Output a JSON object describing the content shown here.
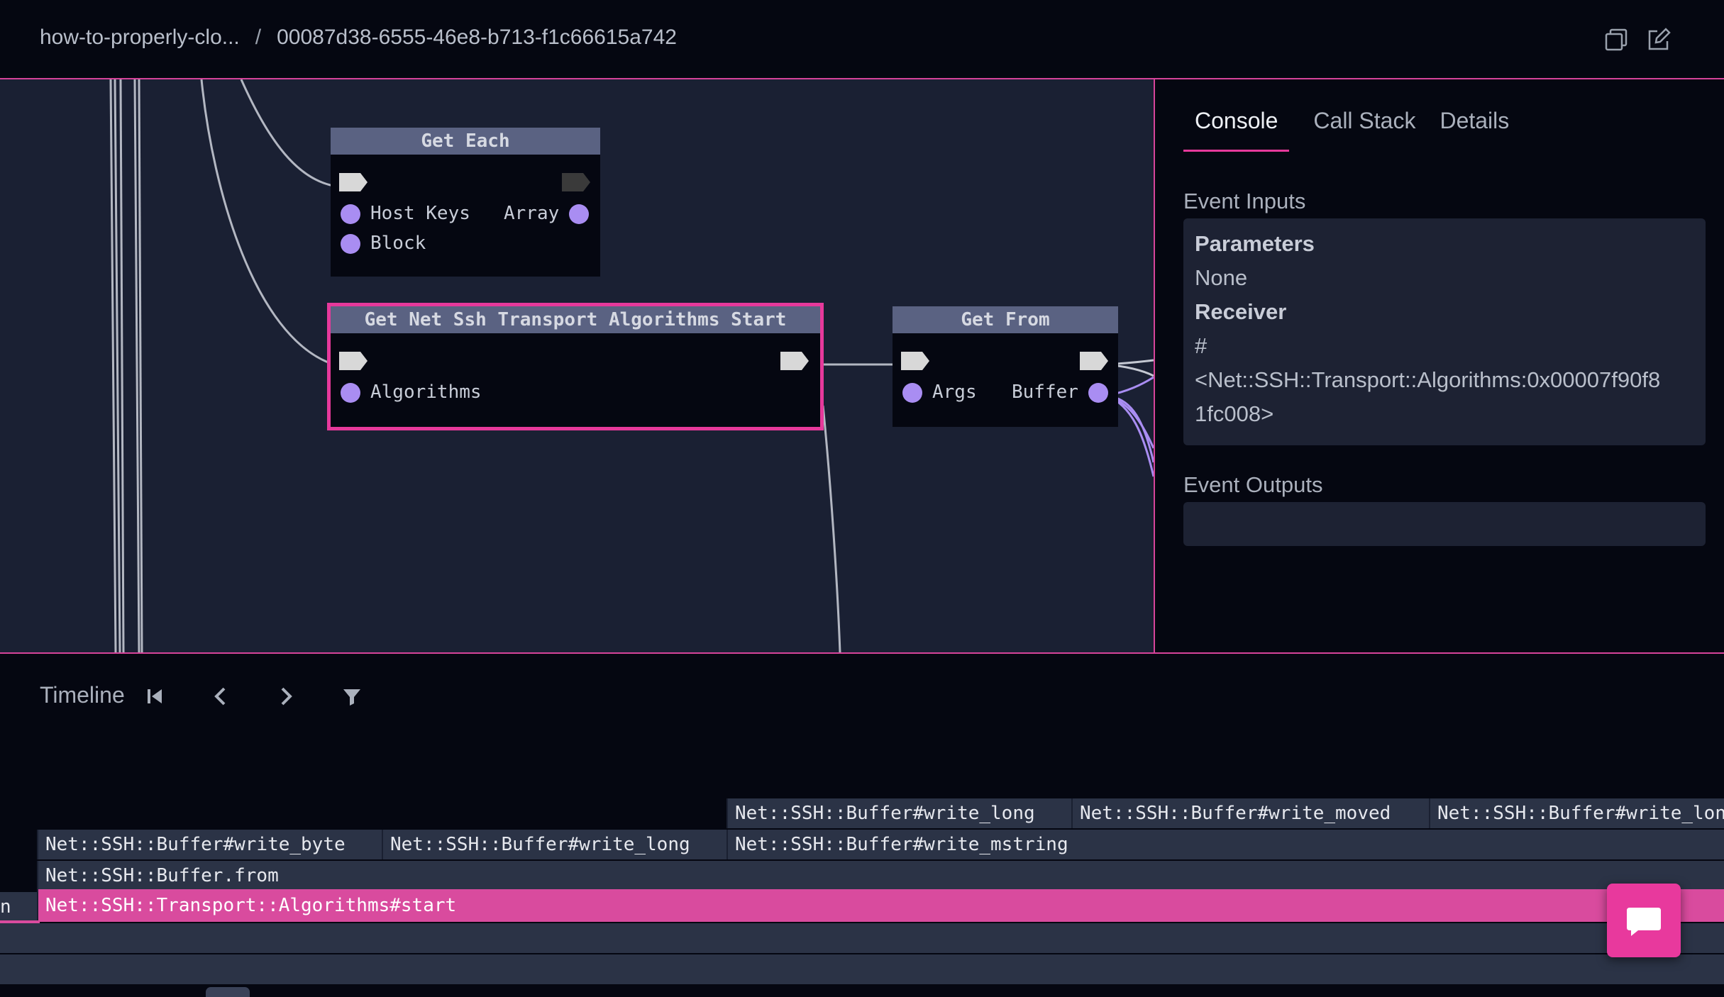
{
  "breadcrumb": {
    "project": "how-to-properly-clo...",
    "separator": "/",
    "run_id": "00087d38-6555-46e8-b713-f1c66615a742"
  },
  "header_icons": [
    "copy-icon",
    "edit-icon"
  ],
  "nodes": {
    "get_each": {
      "title": "Get Each",
      "inputs": [
        "Host Keys",
        "Block"
      ],
      "outputs": [
        "Array"
      ]
    },
    "get_net_ssh": {
      "title": "Get Net Ssh Transport Algorithms Start",
      "inputs": [
        "Algorithms"
      ]
    },
    "get_from": {
      "title": "Get From",
      "inputs": [
        "Args"
      ],
      "outputs": [
        "Buffer"
      ]
    }
  },
  "panel": {
    "tabs": [
      "Console",
      "Call Stack",
      "Details"
    ],
    "active_tab": "Console",
    "event_inputs_label": "Event Inputs",
    "parameters_label": "Parameters",
    "parameters_value": "None",
    "receiver_label": "Receiver",
    "receiver_value_line1": "#",
    "receiver_value_line2": "<Net::SSH::Transport::Algorithms:0x00007f90f8",
    "receiver_value_line3": "1fc008>",
    "event_outputs_label": "Event Outputs"
  },
  "timeline": {
    "label": "Timeline",
    "buttons": [
      "skip-to-start-icon",
      "previous-icon",
      "next-icon",
      "filter-icon"
    ],
    "row1": [
      "Net::SSH::Buffer#write_long",
      "Net::SSH::Buffer#write_moved",
      "Net::SSH::Buffer#write_lon"
    ],
    "row2": [
      "Net::SSH::Buffer#write_byte",
      "Net::SSH::Buffer#write_long",
      "Net::SSH::Buffer#write_mstring"
    ],
    "row3": [
      "Net::SSH::Buffer.from"
    ],
    "row4_left": "n",
    "row4_active": "Net::SSH::Transport::Algorithms#start"
  },
  "colors": {
    "accent": "#e6399b",
    "pin": "#a98df2",
    "node_title": "#5a6282",
    "canvas_bg": "#1a2033"
  }
}
